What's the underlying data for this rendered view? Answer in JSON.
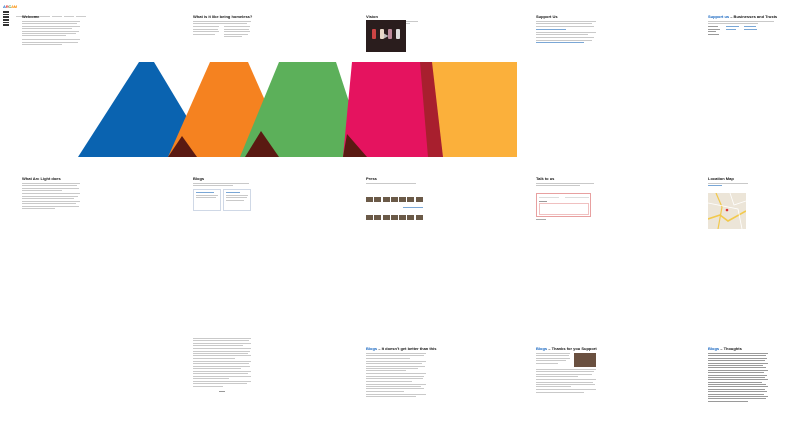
{
  "logo": {
    "part_a": "A",
    "part_r": "R",
    "part_c": "C",
    "part_o": "AM"
  },
  "sections": {
    "welcome": {
      "title": "Welcome"
    },
    "what_is": {
      "title": "What is it like being homeless?"
    },
    "vision": {
      "title": "Vision"
    },
    "support_us": {
      "title": "Support Us"
    },
    "support_us_business": {
      "title_prefix": "Support us",
      "title_suffix": " – Businesses and Trusts"
    },
    "what_arc_light_does": {
      "title": "What Arc Light does"
    },
    "blogs": {
      "title": "Blogs"
    },
    "press": {
      "title": "Press"
    },
    "talk_to_us": {
      "title": "Talk to us"
    },
    "location_map": {
      "title": "Location Map"
    },
    "blog_better": {
      "title_prefix": "Blogs",
      "title_suffix": " – It doesn’t get better than this"
    },
    "blog_thanks": {
      "title_prefix": "Blogs",
      "title_suffix": " – Thanks for you Support"
    },
    "blog_thoughts": {
      "title_prefix": "Blogs",
      "title_suffix": " – Thoughts"
    }
  },
  "colors": {
    "blue": "#0a63b0",
    "orange": "#f58220",
    "green": "#5cb05a",
    "magenta": "#e5135f",
    "yellow": "#fbb03b",
    "dark_red": "#5a1a12",
    "crimson": "#a81f2e"
  },
  "icons": [
    "play-icon",
    "map-pin-icon"
  ]
}
